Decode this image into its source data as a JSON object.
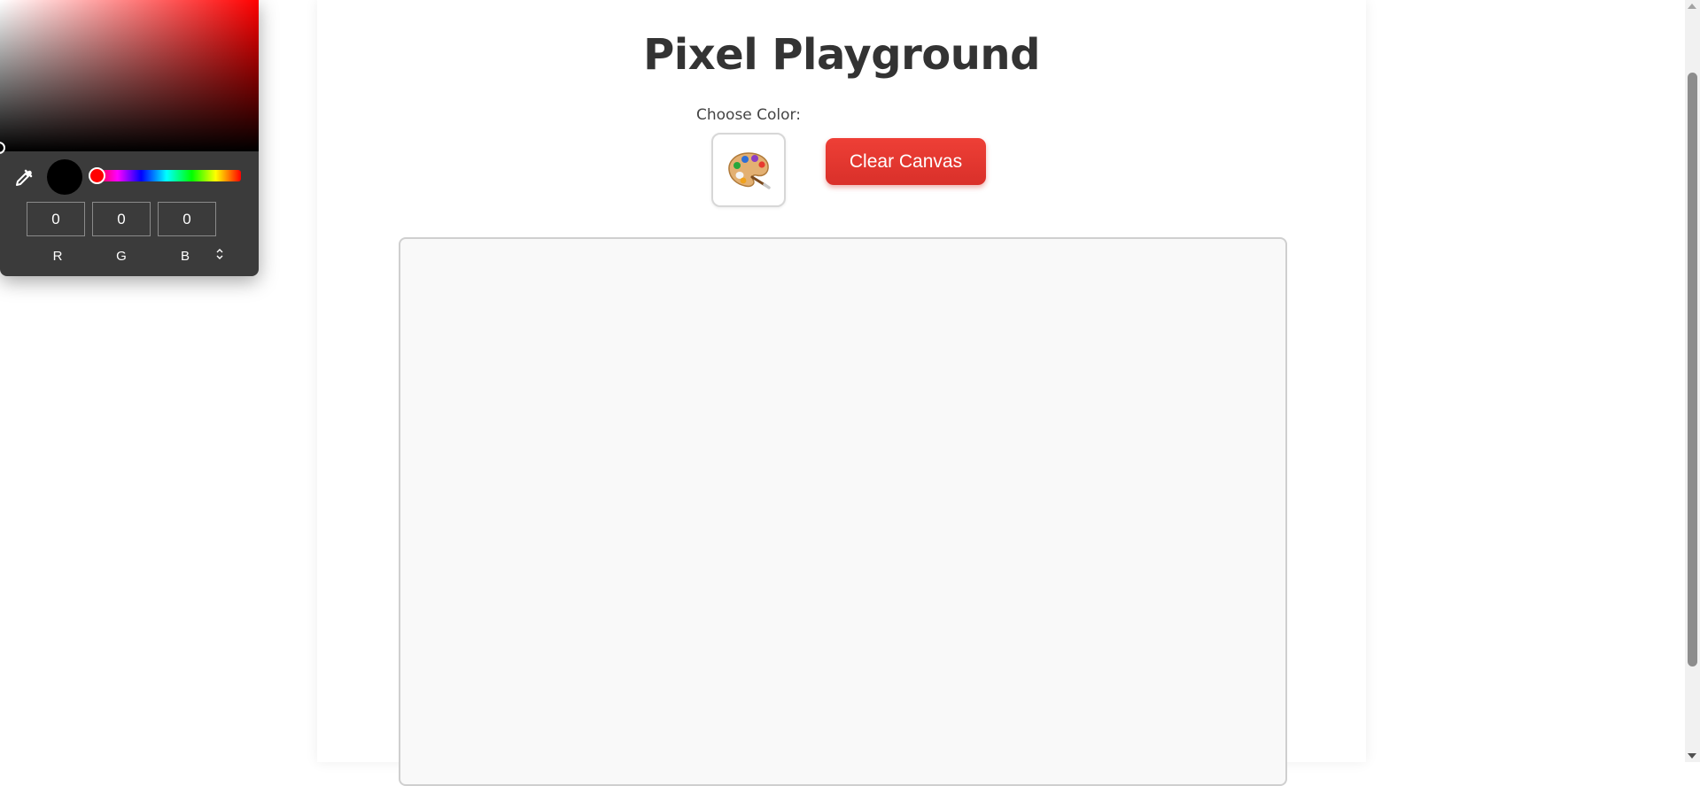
{
  "header": {
    "title": "Pixel Playground"
  },
  "controls": {
    "color_label": "Choose Color:",
    "palette_glyph": "🎨",
    "clear_button_label": "Clear Canvas"
  },
  "picker": {
    "selected_color": "#000000",
    "hue_color": "#ff0000",
    "rgb": {
      "r": "0",
      "g": "0",
      "b": "0"
    },
    "labels": {
      "r": "R",
      "g": "G",
      "b": "B"
    },
    "mode_toggle_glyph": "⌃⌄"
  },
  "colors": {
    "title": "#333333",
    "clear_button": "#e5372f",
    "canvas_bg": "#f9f9f9",
    "picker_bg": "#3b3b3b"
  },
  "icons": [
    "eyedropper-icon",
    "palette-icon",
    "scroll-up-arrow-icon",
    "scroll-down-arrow-icon"
  ]
}
